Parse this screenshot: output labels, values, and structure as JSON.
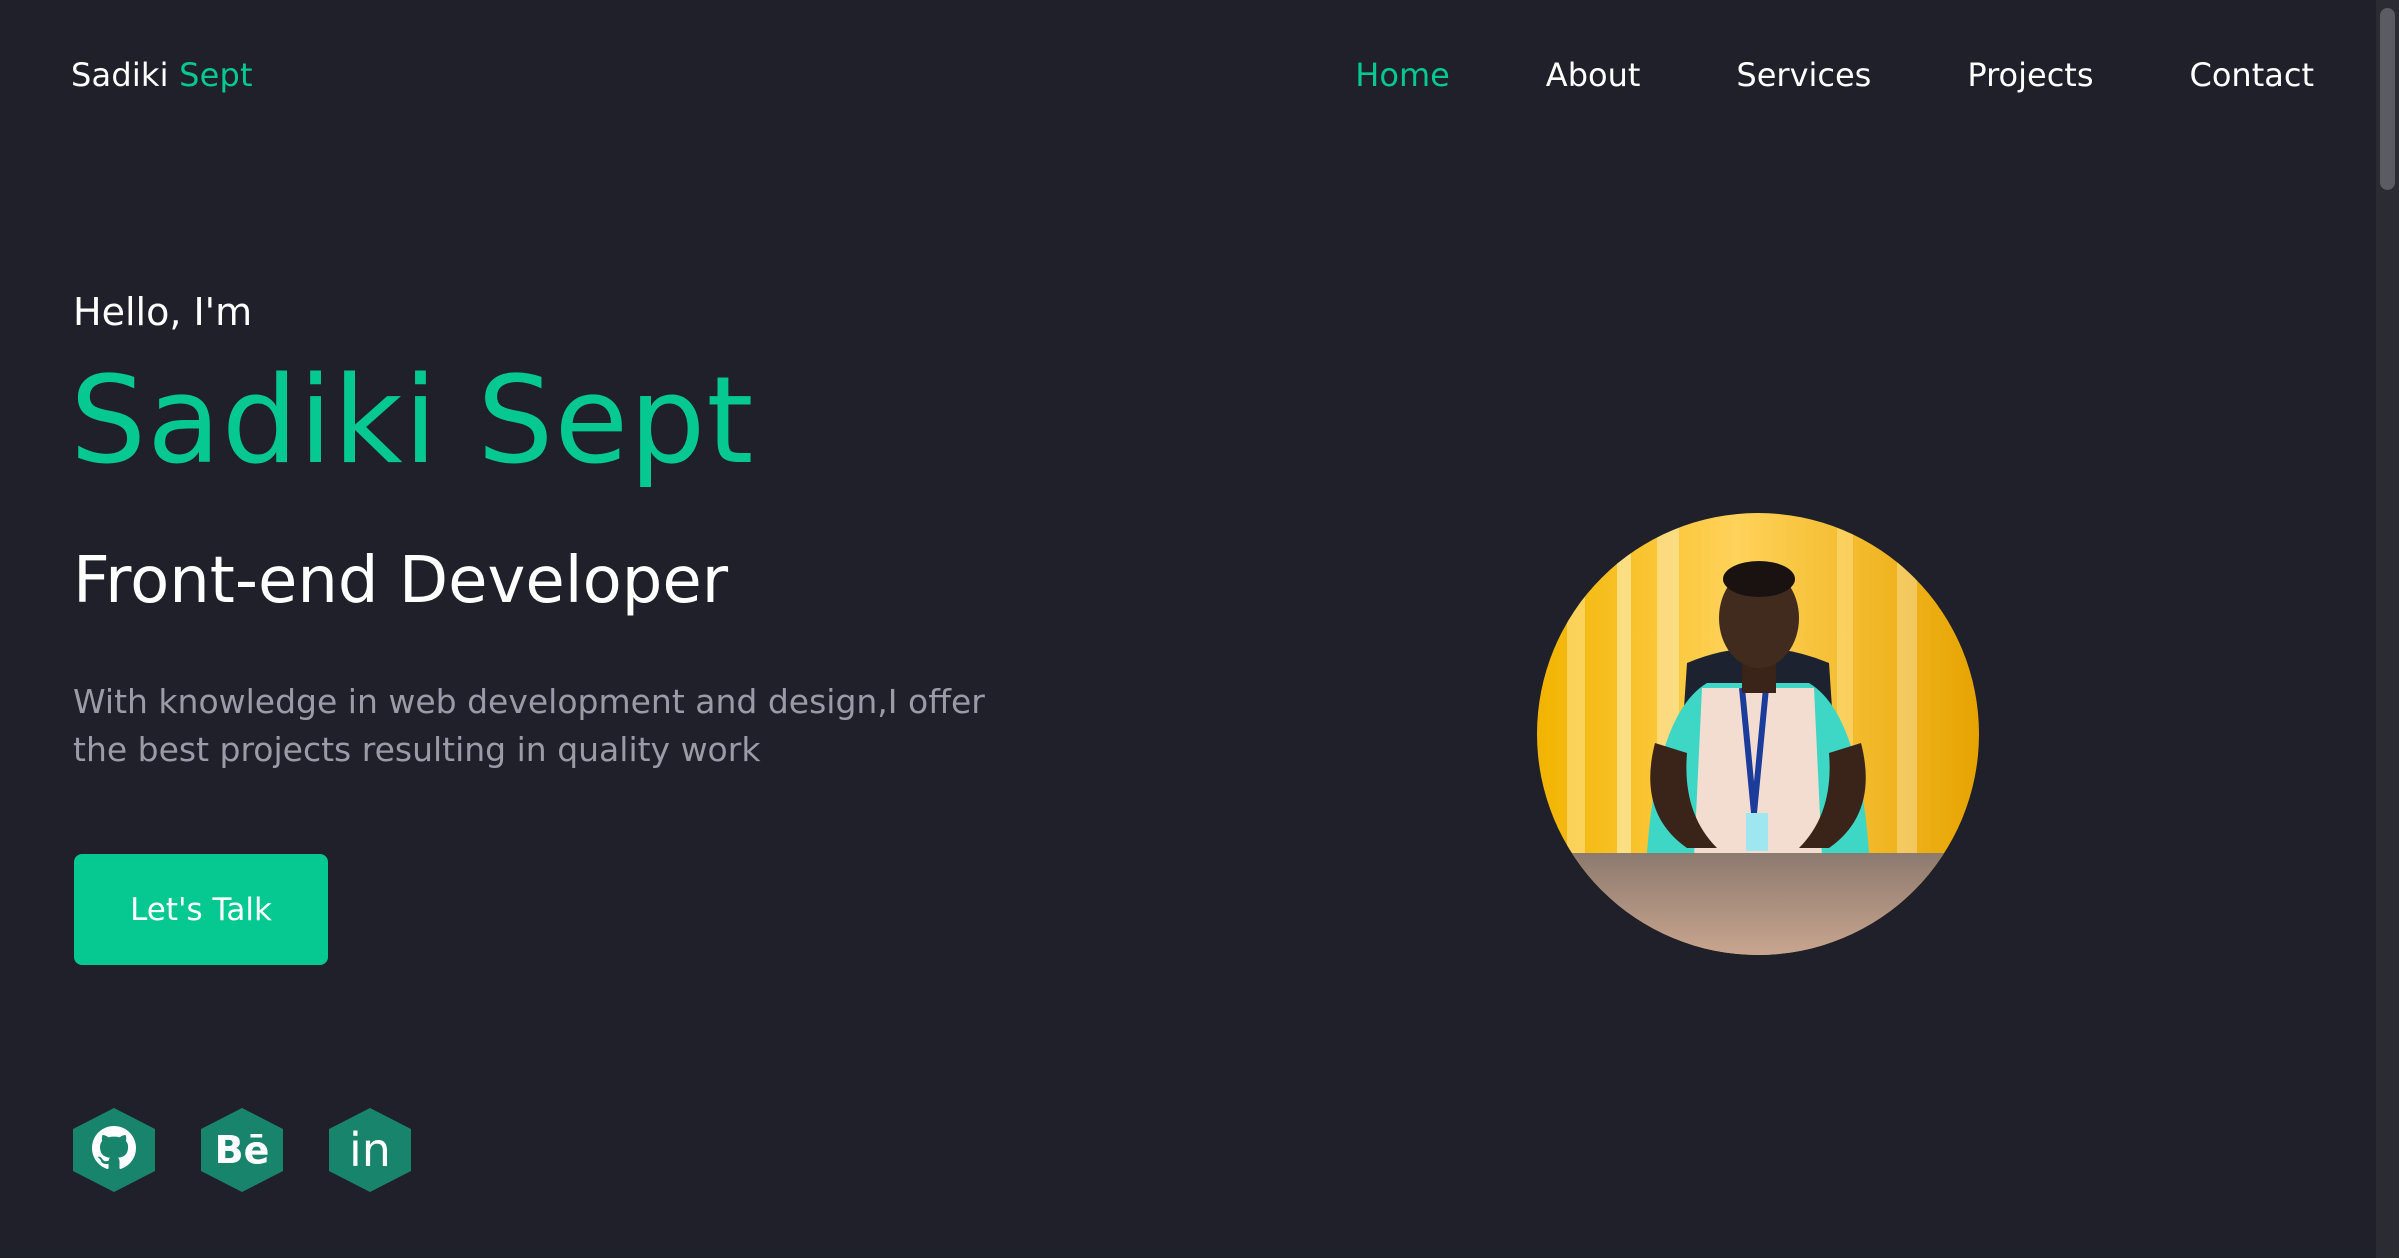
{
  "logo": {
    "first": "Sadiki",
    "accent": "Sept"
  },
  "nav": {
    "items": [
      {
        "label": "Home",
        "active": true
      },
      {
        "label": "About",
        "active": false
      },
      {
        "label": "Services",
        "active": false
      },
      {
        "label": "Projects",
        "active": false
      },
      {
        "label": "Contact",
        "active": false
      }
    ]
  },
  "hero": {
    "greeting": "Hello, I'm",
    "name": "Sadiki Sept",
    "role": "Front-end Developer",
    "description_line1": "With knowledge in web development and design,I offer",
    "description_line2": "the best projects resulting in quality work",
    "cta_label": "Let's Talk"
  },
  "socials": [
    {
      "icon": "github-icon"
    },
    {
      "icon": "behance-icon",
      "glyph": "Bē"
    },
    {
      "icon": "linkedin-icon",
      "glyph": "in"
    }
  ],
  "colors": {
    "background": "#1f2029",
    "accent": "#05c990",
    "social_bg": "#18846b",
    "muted_text": "#9a9ba8"
  }
}
